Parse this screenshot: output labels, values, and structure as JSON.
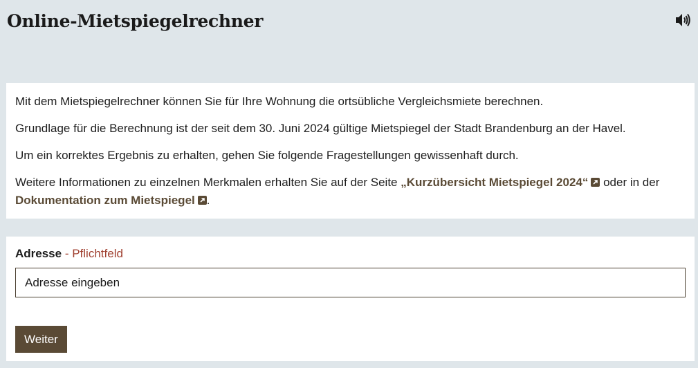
{
  "header": {
    "title": "Online-Mietspiegelrechner",
    "speaker_icon": "speaker-volume-icon"
  },
  "info": {
    "p1": "Mit dem Mietspiegelrechner können Sie für Ihre Wohnung die ortsübliche Vergleichsmiete berechnen.",
    "p2": "Grundlage für die Berechnung ist der seit dem 30. Juni 2024 gültige Mietspiegel der Stadt Brandenburg an der Havel.",
    "p3": "Um ein korrektes Ergebnis zu erhalten, gehen Sie folgende Fragestellungen gewissenhaft durch.",
    "p4_prefix": "Weitere Informationen zu einzelnen Merkmalen erhalten Sie auf der Seite ",
    "link1": "„Kurzübersicht Mietspiegel 2024“",
    "p4_middle": " oder in der ",
    "link2": "Dokumentation zum Mietspiegel",
    "p4_suffix": ".",
    "external_link_icon": "external-link-icon"
  },
  "form": {
    "address_label": "Adresse",
    "separator": " - ",
    "required_label": "Pflichtfeld",
    "address_placeholder": "Adresse eingeben",
    "submit_label": "Weiter"
  },
  "colors": {
    "background": "#dfe6ea",
    "accent": "#5a4a35",
    "required": "#a04030"
  }
}
